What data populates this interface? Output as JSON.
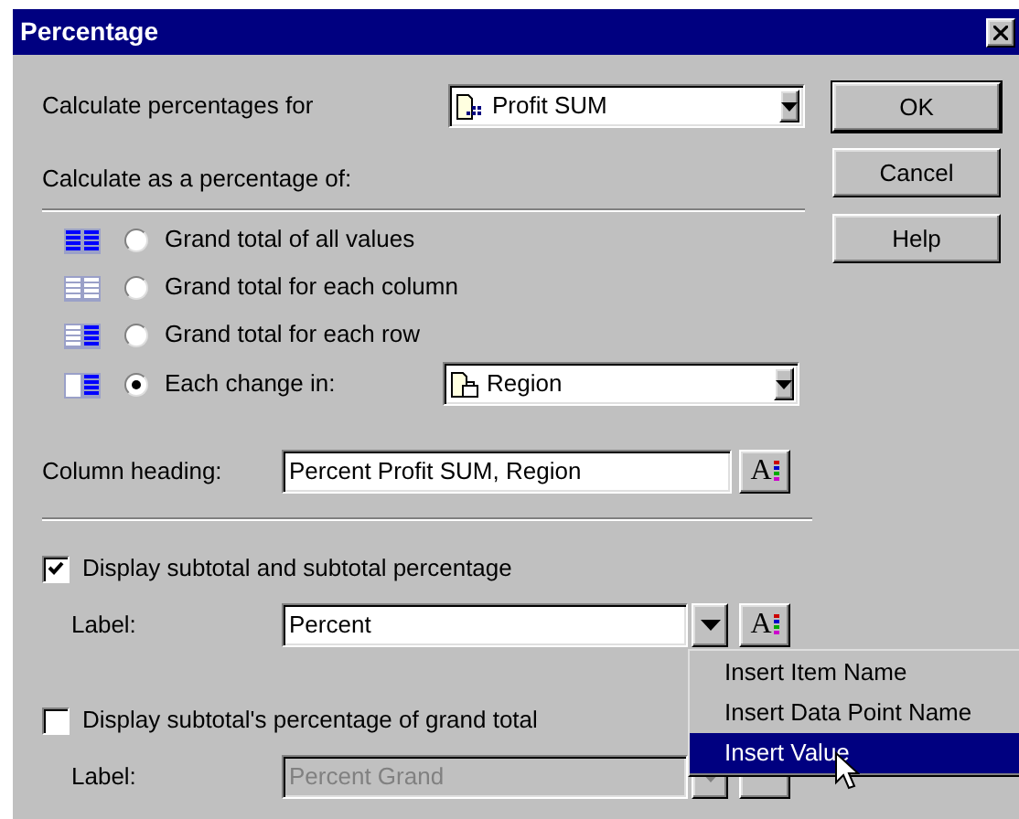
{
  "window": {
    "title": "Percentage"
  },
  "calculate_for": {
    "label": "Calculate percentages for",
    "value": "Profit SUM"
  },
  "buttons": [
    {
      "label": "OK",
      "default": true
    },
    {
      "label": "Cancel",
      "default": false
    },
    {
      "label": "Help",
      "default": false
    }
  ],
  "percentage_of": {
    "heading": "Calculate as a percentage of:",
    "options": [
      {
        "kind": "all",
        "label": "Grand total of all values",
        "selected": false
      },
      {
        "kind": "column",
        "label": "Grand total for each column",
        "selected": false
      },
      {
        "kind": "row",
        "label": "Grand total for each row",
        "selected": false
      },
      {
        "kind": "change",
        "label": "Each change in:",
        "selected": true
      }
    ],
    "change_field": {
      "value": "Region"
    }
  },
  "column_heading": {
    "label": "Column heading:",
    "value": "Percent Profit SUM, Region",
    "font_glyph": "A"
  },
  "subtotal": {
    "label": "Display subtotal and subtotal percentage",
    "checked": true,
    "field_label": "Label:",
    "value": "Percent",
    "disabled": false,
    "font_glyph": "A"
  },
  "grand_total": {
    "label": "Display subtotal's percentage of grand total",
    "checked": false,
    "field_label": "Label:",
    "value": "Percent Grand",
    "disabled": true
  },
  "insert_menu": {
    "items": [
      {
        "label": "Insert Item Name",
        "selected": false
      },
      {
        "label": "Insert Data Point Name",
        "selected": false
      },
      {
        "label": "Insert Value",
        "selected": true
      }
    ]
  }
}
